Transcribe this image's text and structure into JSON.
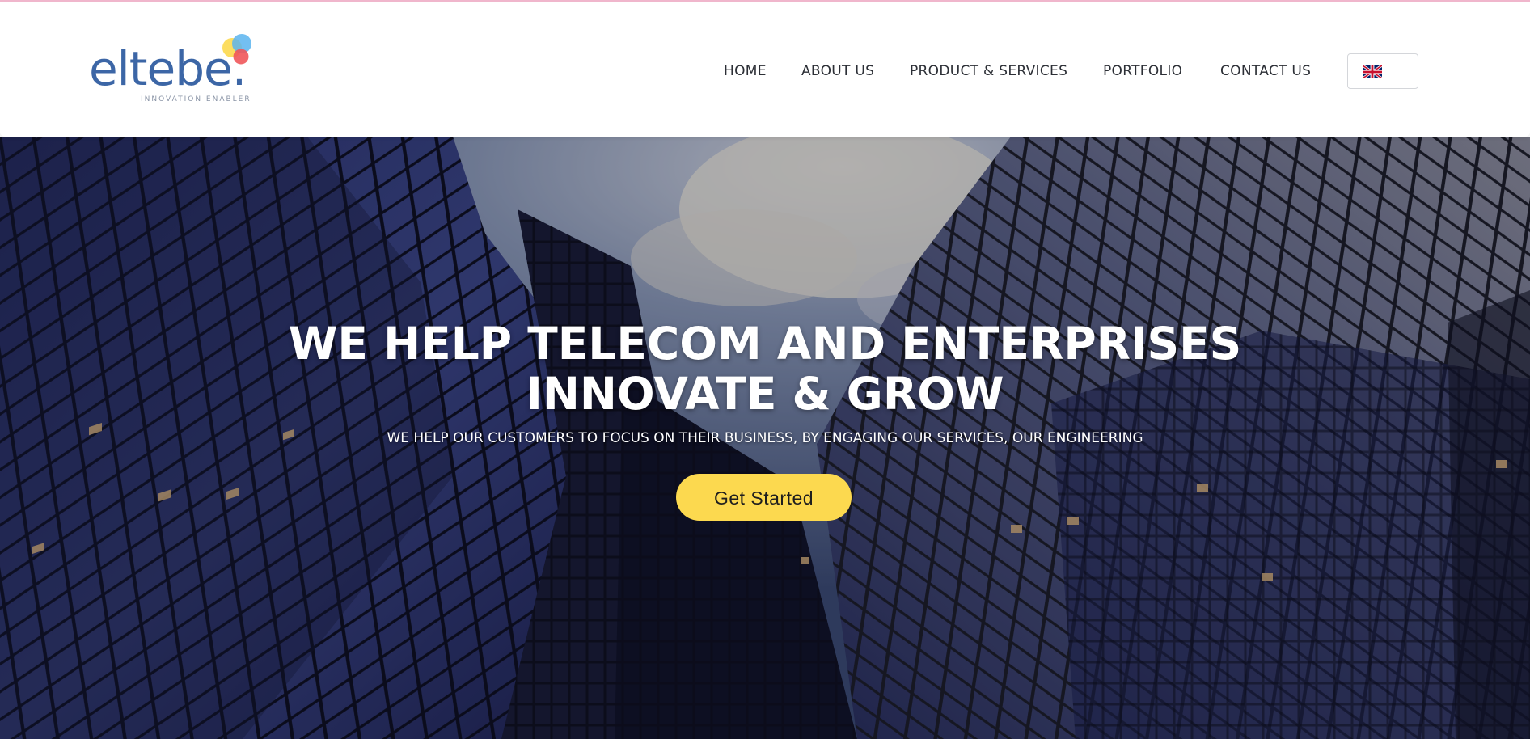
{
  "brand": {
    "name": "eltebe.",
    "tagline": "INNOVATION ENABLER",
    "colors": {
      "word": "#3c66a6",
      "dot_yellow": "#fcd94f",
      "dot_blue": "#5ab4ee",
      "dot_red": "#f0565a"
    }
  },
  "nav": {
    "items": [
      {
        "label": "HOME"
      },
      {
        "label": "ABOUT US"
      },
      {
        "label": "PRODUCT & SERVICES"
      },
      {
        "label": "PORTFOLIO"
      },
      {
        "label": "CONTACT US"
      }
    ],
    "language": {
      "icon": "uk-flag-icon",
      "selected": "English"
    }
  },
  "hero": {
    "title_line1": "WE HELP TELECOM AND ENTERPRISES",
    "title_line2": "INNOVATE & GROW",
    "subtitle": "WE HELP OUR CUSTOMERS TO FOCUS ON THEIR BUSINESS, BY ENGAGING OUR SERVICES, OUR ENGINEERING",
    "cta_label": "Get Started",
    "background": "glass skyscrapers viewed from below against cloudy sky",
    "accent": "#fcd94f"
  }
}
